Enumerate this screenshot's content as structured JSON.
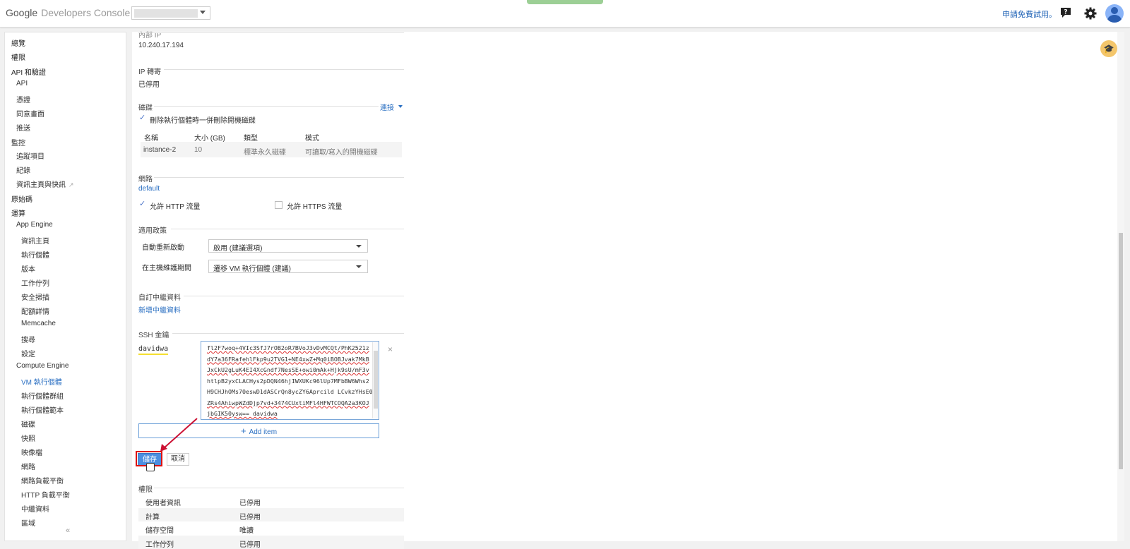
{
  "header": {
    "logo_google": "Google",
    "logo_dc": "Developers Console",
    "trial": "申請免費試用。"
  },
  "sidebar": {
    "items": [
      {
        "label": "總覽",
        "level": 0
      },
      {
        "label": "權限",
        "level": 0
      },
      {
        "label": "API 和驗證",
        "level": 0
      },
      {
        "label": "API",
        "level": 1
      },
      {
        "label": "憑證",
        "level": 1
      },
      {
        "label": "同意畫面",
        "level": 1
      },
      {
        "label": "推送",
        "level": 1
      },
      {
        "label": "監控",
        "level": 0
      },
      {
        "label": "追蹤項目",
        "level": 1
      },
      {
        "label": "紀錄",
        "level": 1
      },
      {
        "label": "資訊主頁與快訊",
        "level": 1
      },
      {
        "label": "原始碼",
        "level": 0
      },
      {
        "label": "運算",
        "level": 0
      },
      {
        "label": "App Engine",
        "level": 1
      },
      {
        "label": "資訊主頁",
        "level": 2
      },
      {
        "label": "執行個體",
        "level": 2
      },
      {
        "label": "版本",
        "level": 2
      },
      {
        "label": "工作佇列",
        "level": 2
      },
      {
        "label": "安全掃描",
        "level": 2
      },
      {
        "label": "配額詳情",
        "level": 2
      },
      {
        "label": "Memcache",
        "level": 2
      },
      {
        "label": "搜尋",
        "level": 2
      },
      {
        "label": "設定",
        "level": 2
      },
      {
        "label": "Compute Engine",
        "level": 1
      },
      {
        "label": "VM 執行個體",
        "level": 2
      },
      {
        "label": "執行個體群組",
        "level": 2
      },
      {
        "label": "執行個體範本",
        "level": 2
      },
      {
        "label": "磁碟",
        "level": 2
      },
      {
        "label": "快照",
        "level": 2
      },
      {
        "label": "映像檔",
        "level": 2
      },
      {
        "label": "網路",
        "level": 2
      },
      {
        "label": "網路負載平衡",
        "level": 2
      },
      {
        "label": "HTTP 負載平衡",
        "level": 2
      },
      {
        "label": "中繼資料",
        "level": 2
      },
      {
        "label": "區域",
        "level": 2
      }
    ],
    "collapse": "«"
  },
  "internal_ip": {
    "label": "內部 IP",
    "value": "10.240.17.194"
  },
  "ip_forward": {
    "label": "IP 轉寄",
    "value": "已停用"
  },
  "disk": {
    "label": "磁碟",
    "connect": "連接",
    "delete_label": "刪除執行個體時一併刪除開機磁碟",
    "headers": [
      "名稱",
      "大小 (GB)",
      "類型",
      "模式"
    ],
    "row": [
      "instance-2",
      "10",
      "標準永久磁碟",
      "可讀取/寫入的開機磁碟"
    ]
  },
  "network": {
    "label": "網路",
    "value": "default",
    "http": "允許 HTTP 流量",
    "https": "允許 HTTPS 流量"
  },
  "policy": {
    "label": "適用政策",
    "restart_label": "自動重新啟動",
    "restart_value": "啟用 (建議選項)",
    "maint_label": "在主機維護期間",
    "maint_value": "遷移 VM 執行個體 (建議)"
  },
  "metadata": {
    "label": "自訂中繼資料",
    "add": "新增中繼資料"
  },
  "ssh": {
    "label": "SSH 金鑰",
    "user": "davidwa",
    "key_lines": [
      "fl2F7woq+4VIc3SfJ7rOB2oR7BVoJ3vDvMCQt/PhK2521z",
      "dY7a36FRafehlFkp9u2TVG1+NE4xwZ+Mq0iBOBJvak7MkB",
      "JxCkU2gLuK4EI4XcGndf7NesSE+owi0mAk+Hjk9sU/mF3v",
      "htlpB2yxCLACHys2pDQN46hjIWXUKc96lUp7MFbBW6Whs2",
      "H9CHJhOMs70eswD1dASCrQn8ycZY6Aprcild LCvkzYHsE0",
      "ZRs4AhiwpWZdDjp7vd+3474CUxtiMFl4HFWTCOQA2a3KOJ",
      "jbGIK50ysw== davidwa"
    ],
    "close": "×",
    "add_item": "Add item"
  },
  "buttons": {
    "save": "儲存",
    "cancel": "取消"
  },
  "permissions": {
    "label": "權限",
    "rows": [
      {
        "k": "使用者資訊",
        "v": "已停用"
      },
      {
        "k": "計算",
        "v": "已停用"
      },
      {
        "k": "儲存空間",
        "v": "唯讀"
      },
      {
        "k": "工作佇列",
        "v": "已停用"
      }
    ]
  },
  "colors": {
    "accent": "#2a6fc2",
    "save_button": "#4d8fe0",
    "highlight_box": "#dd1111",
    "arrow": "#cc1133"
  }
}
